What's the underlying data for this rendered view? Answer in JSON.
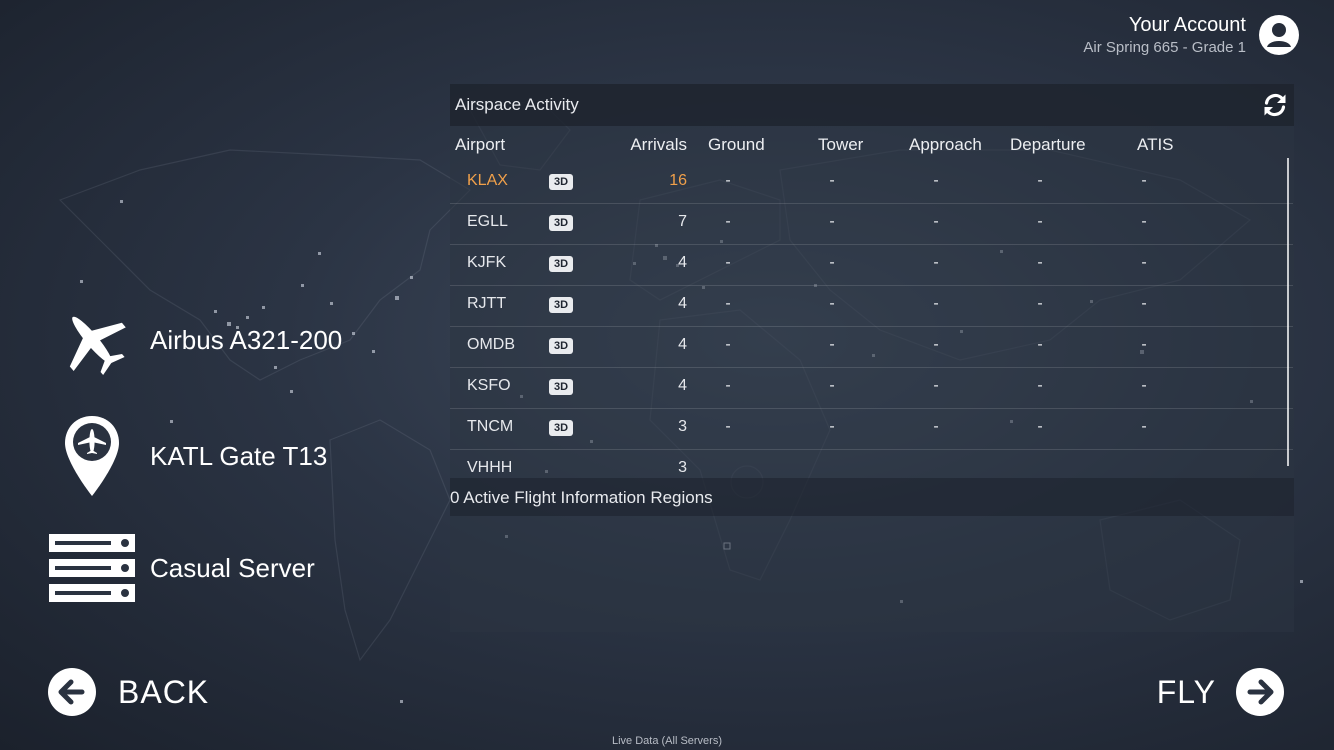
{
  "account": {
    "title": "Your Account",
    "subtitle": "Air Spring 665 - Grade 1",
    "icon": "user-circle-icon"
  },
  "menu": {
    "aircraft": {
      "label": "Airbus A321-200",
      "icon": "airplane-icon"
    },
    "location": {
      "label": "KATL Gate T13",
      "icon": "map-pin-plane-icon"
    },
    "server": {
      "label": "Casual Server",
      "icon": "server-icon"
    }
  },
  "panel": {
    "title": "Airspace Activity",
    "refresh_icon": "refresh-icon",
    "columns": {
      "airport": "Airport",
      "arrivals": "Arrivals",
      "ground": "Ground",
      "tower": "Tower",
      "approach": "Approach",
      "departure": "Departure",
      "atis": "ATIS"
    },
    "badge": "3D",
    "rows": [
      {
        "code": "KLAX",
        "arrivals": "16",
        "ground": "-",
        "tower": "-",
        "approach": "-",
        "departure": "-",
        "atis": "-",
        "highlight": true
      },
      {
        "code": "EGLL",
        "arrivals": "7",
        "ground": "-",
        "tower": "-",
        "approach": "-",
        "departure": "-",
        "atis": "-"
      },
      {
        "code": "KJFK",
        "arrivals": "4",
        "ground": "-",
        "tower": "-",
        "approach": "-",
        "departure": "-",
        "atis": "-"
      },
      {
        "code": "RJTT",
        "arrivals": "4",
        "ground": "-",
        "tower": "-",
        "approach": "-",
        "departure": "-",
        "atis": "-"
      },
      {
        "code": "OMDB",
        "arrivals": "4",
        "ground": "-",
        "tower": "-",
        "approach": "-",
        "departure": "-",
        "atis": "-"
      },
      {
        "code": "KSFO",
        "arrivals": "4",
        "ground": "-",
        "tower": "-",
        "approach": "-",
        "departure": "-",
        "atis": "-"
      },
      {
        "code": "TNCM",
        "arrivals": "3",
        "ground": "-",
        "tower": "-",
        "approach": "-",
        "departure": "-",
        "atis": "-"
      },
      {
        "code": "VHHH",
        "arrivals": "3",
        "ground": "",
        "tower": "",
        "approach": "",
        "departure": "",
        "atis": ""
      }
    ],
    "fir_text": "0 Active Flight Information Regions",
    "highlight_color": "#f0a04a"
  },
  "nav": {
    "back_label": "BACK",
    "fly_label": "FLY",
    "back_icon": "arrow-left-circle-icon",
    "fly_icon": "arrow-right-circle-icon"
  },
  "footer": {
    "text": "Live Data (All Servers)"
  }
}
